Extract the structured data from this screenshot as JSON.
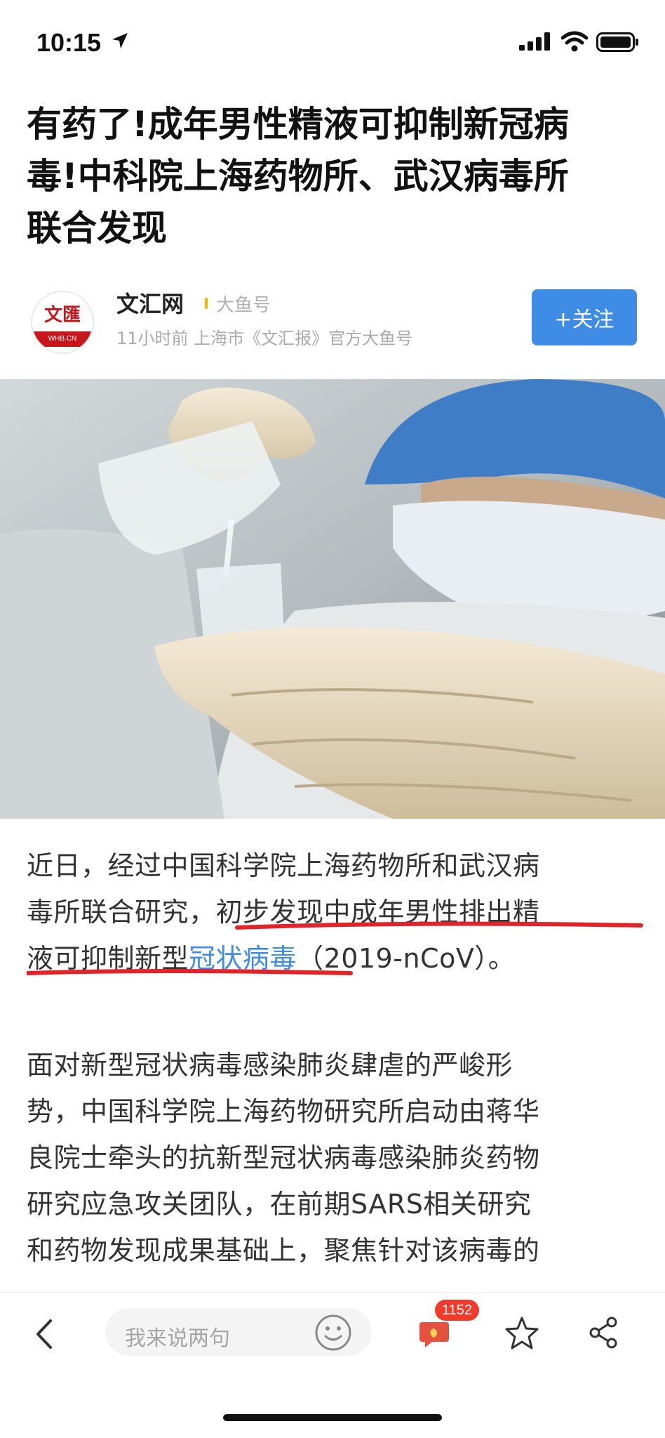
{
  "status_bar": {
    "time": "10:15",
    "icons": [
      "location-arrow-icon",
      "signal-icon",
      "wifi-icon",
      "battery-icon"
    ]
  },
  "article": {
    "title_lines": [
      "有药了!成年男性精液可抑制新冠病",
      "毒!中科院上海药物所、武汉病毒所",
      "联合发现"
    ]
  },
  "author": {
    "logo_text": "文匯",
    "logo_sub": "WHB.CN",
    "name": "文汇网",
    "tag": "大鱼号",
    "meta": "11小时前  上海市《文汇报》官方大鱼号",
    "follow_label": "+关注",
    "follow_color": "#3e8ce6"
  },
  "hero": {
    "icon": "lab-photo-image"
  },
  "body": {
    "para1": {
      "line1": "近日，经过中国科学院上海药物所和武汉病",
      "line2a": "毒所联合研究，",
      "line2b": "初步发现中成年男性排出精",
      "line3a": "液可抑制新型",
      "line3_link": "冠状病毒",
      "line3b": "（2019-nCoV）。"
    },
    "para2_lines": [
      "面对新型冠状病毒感染肺炎肆虐的严峻形",
      "势，中国科学院上海药物研究所启动由蒋华",
      "良院士牵头的抗新型冠状病毒感染肺炎药物",
      "研究应急攻关团队，在前期SARS相关研究",
      "和药物发现成果基础上，聚焦针对该病毒的"
    ],
    "link_color": "#3e8ce6",
    "underline_color": "#e0242a"
  },
  "bottom_bar": {
    "comment_placeholder": "我来说两句",
    "comment_count": "1152",
    "icons": [
      "back-icon",
      "emoji-icon",
      "comments-icon",
      "star-icon",
      "share-icon"
    ]
  }
}
